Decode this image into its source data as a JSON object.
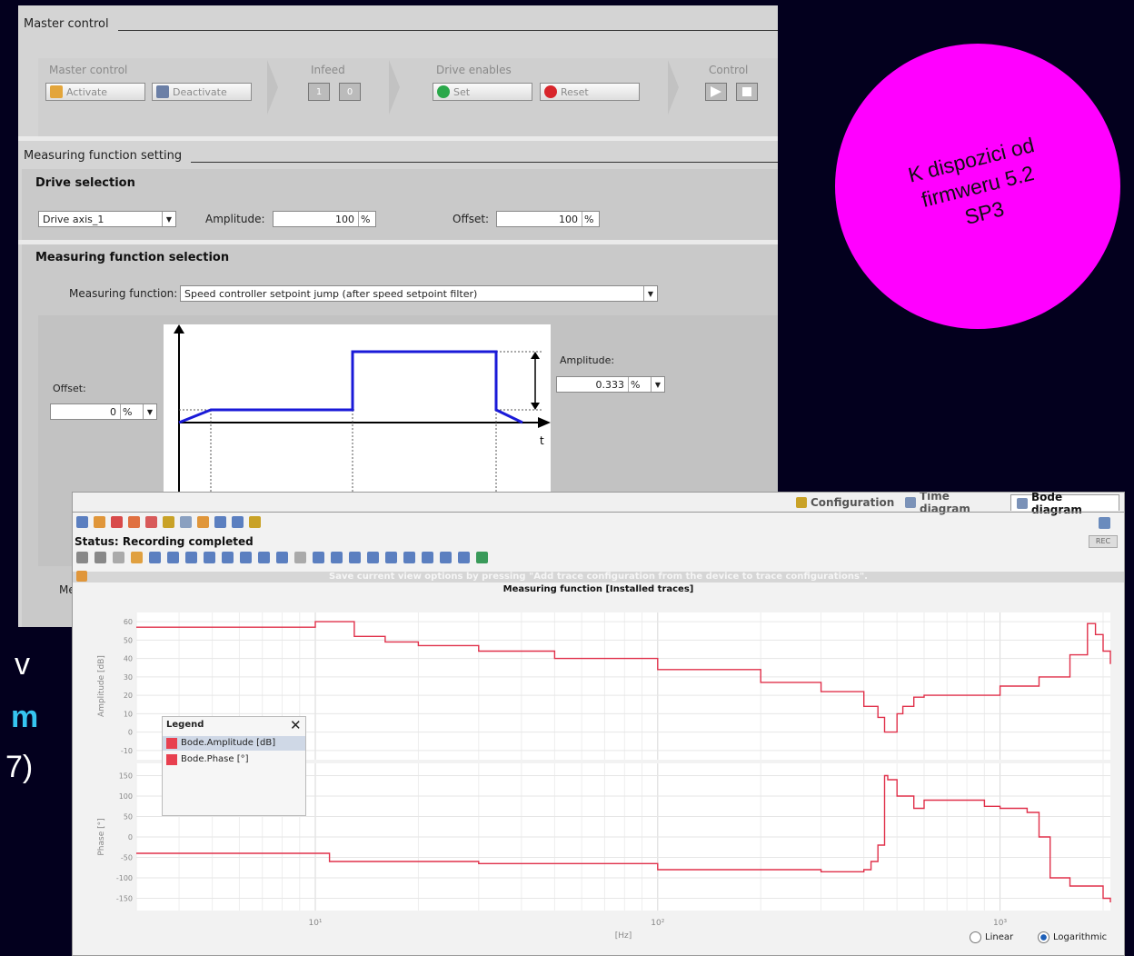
{
  "slide": {
    "frag_v": "v",
    "frag_m": "m",
    "frag_7": "7)"
  },
  "badge": {
    "line1": "K dispozici od",
    "line2": "firmweru 5.2",
    "line3": "SP3"
  },
  "master_control": {
    "section_title": "Master control",
    "groups": {
      "master": "Master control",
      "infeed": "Infeed",
      "drive_enables": "Drive enables",
      "control": "Control"
    },
    "activate_label": "Activate",
    "deactivate_label": "Deactivate",
    "infeed_on": "1",
    "infeed_off": "0",
    "set_label": "Set",
    "reset_label": "Reset"
  },
  "measuring_setting": {
    "section_title": "Measuring function setting",
    "drive_selection_title": "Drive selection",
    "drive_value": "Drive axis_1",
    "amplitude_label": "Amplitude:",
    "amplitude_value": "100",
    "amplitude_unit": "%",
    "offset_label": "Offset:",
    "offset_value": "100",
    "offset_unit": "%",
    "mf_selection_title": "Measuring function selection",
    "mf_label": "Measuring function:",
    "mf_value": "Speed controller setpoint jump (after speed setpoint filter)",
    "diagram": {
      "offset_label": "Offset:",
      "offset_value": "0",
      "offset_unit": "%",
      "amplitude_label": "Amplitude:",
      "amplitude_value": "0.333",
      "amplitude_unit": "%",
      "t_label": "t"
    },
    "cut_label": "Me"
  },
  "trace": {
    "tabs": [
      "Configuration",
      "Time diagram",
      "Bode diagram"
    ],
    "status": "Status: Recording completed",
    "rec_label": "REC",
    "hint": "Save current view options by pressing \"Add trace configuration from the device to trace configurations\".",
    "plot_title": "Measuring function [Installed traces]",
    "legend_title": "Legend",
    "legend_items": [
      "Bode.Amplitude [dB]",
      "Bode.Phase [°]"
    ],
    "scale_linear": "Linear",
    "scale_log": "Logarithmic"
  },
  "chart_data": [
    {
      "type": "line",
      "title": "Measuring function [Installed traces]",
      "ylabel": "Amplitude [dB]",
      "x_scale": "log",
      "xlim": [
        3,
        2100
      ],
      "ylim": [
        -15,
        65
      ],
      "yticks": [
        -10,
        0,
        10,
        20,
        30,
        40,
        50,
        60
      ],
      "grid": true,
      "series": [
        {
          "name": "Bode.Amplitude [dB]",
          "color": "#e0304a",
          "x": [
            3,
            6,
            10,
            12,
            13,
            16,
            20,
            30,
            50,
            100,
            200,
            300,
            400,
            440,
            460,
            500,
            520,
            560,
            600,
            700,
            1000,
            1300,
            1600,
            1800,
            1900,
            2000,
            2100
          ],
          "y": [
            57,
            57,
            60,
            60,
            52,
            49,
            47,
            44,
            40,
            34,
            27,
            22,
            14,
            8,
            0,
            10,
            14,
            19,
            20,
            20,
            25,
            30,
            42,
            59,
            53,
            44,
            37
          ]
        }
      ]
    },
    {
      "type": "line",
      "ylabel": "Phase [°]",
      "xlabel": "[Hz]",
      "x_scale": "log",
      "xlim": [
        3,
        2100
      ],
      "ylim": [
        -180,
        180
      ],
      "yticks": [
        -150,
        -100,
        -50,
        0,
        50,
        100,
        150
      ],
      "xticks": [
        "10¹",
        "10²",
        "10³"
      ],
      "grid": true,
      "series": [
        {
          "name": "Bode.Phase [°]",
          "color": "#e0304a",
          "x": [
            3,
            10,
            11,
            30,
            100,
            300,
            400,
            420,
            440,
            460,
            470,
            500,
            560,
            600,
            700,
            900,
            1000,
            1200,
            1300,
            1400,
            1600,
            2000,
            2100
          ],
          "y": [
            -40,
            -40,
            -60,
            -65,
            -80,
            -85,
            -80,
            -60,
            -20,
            150,
            140,
            100,
            70,
            90,
            90,
            75,
            70,
            60,
            0,
            -100,
            -120,
            -150,
            -160
          ]
        }
      ]
    }
  ]
}
